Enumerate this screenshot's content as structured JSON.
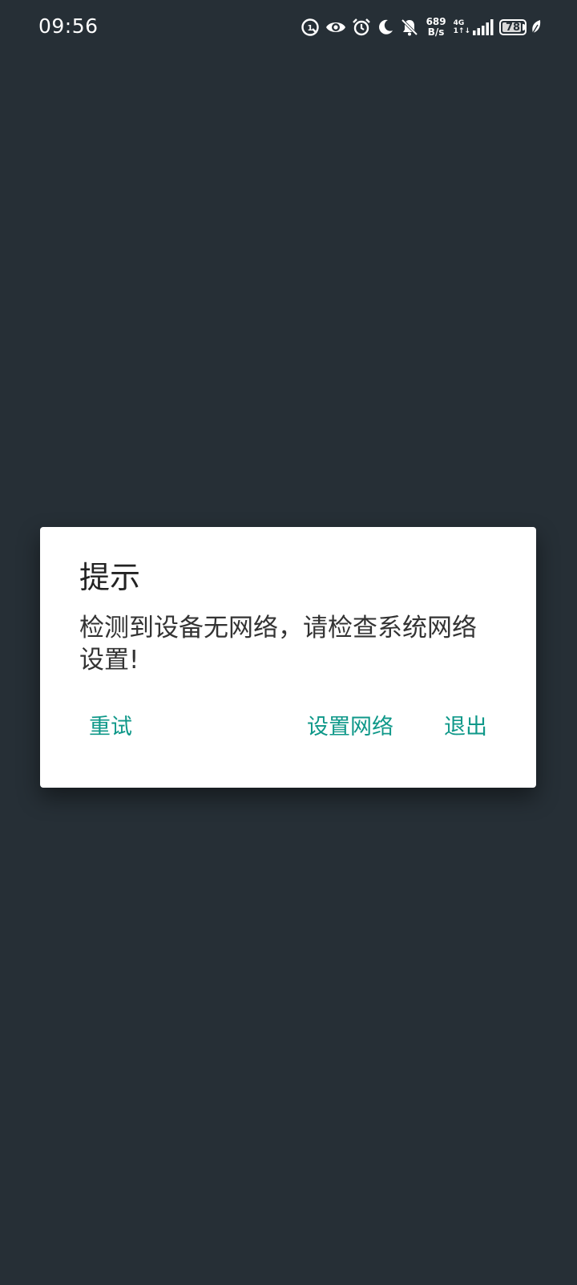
{
  "status_bar": {
    "time": "09:56",
    "net_speed_value": "689",
    "net_speed_unit": "B/s",
    "signal_type": "4G",
    "signal_sub": "1↑↓",
    "battery_level": "78",
    "icons": [
      "data-saver-icon",
      "eye-comfort-icon",
      "alarm-icon",
      "do-not-disturb-icon",
      "notifications-muted-icon",
      "signal-icon",
      "battery-icon",
      "power-saving-leaf-icon"
    ]
  },
  "dialog": {
    "title": "提示",
    "message": "检测到设备无网络，请检查系统网络设置!",
    "buttons": {
      "retry": "重试",
      "settings": "设置网络",
      "exit": "退出"
    },
    "accent_color": "#0f9889"
  },
  "colors": {
    "background": "#262f36",
    "dialog_background": "#ffffff"
  }
}
